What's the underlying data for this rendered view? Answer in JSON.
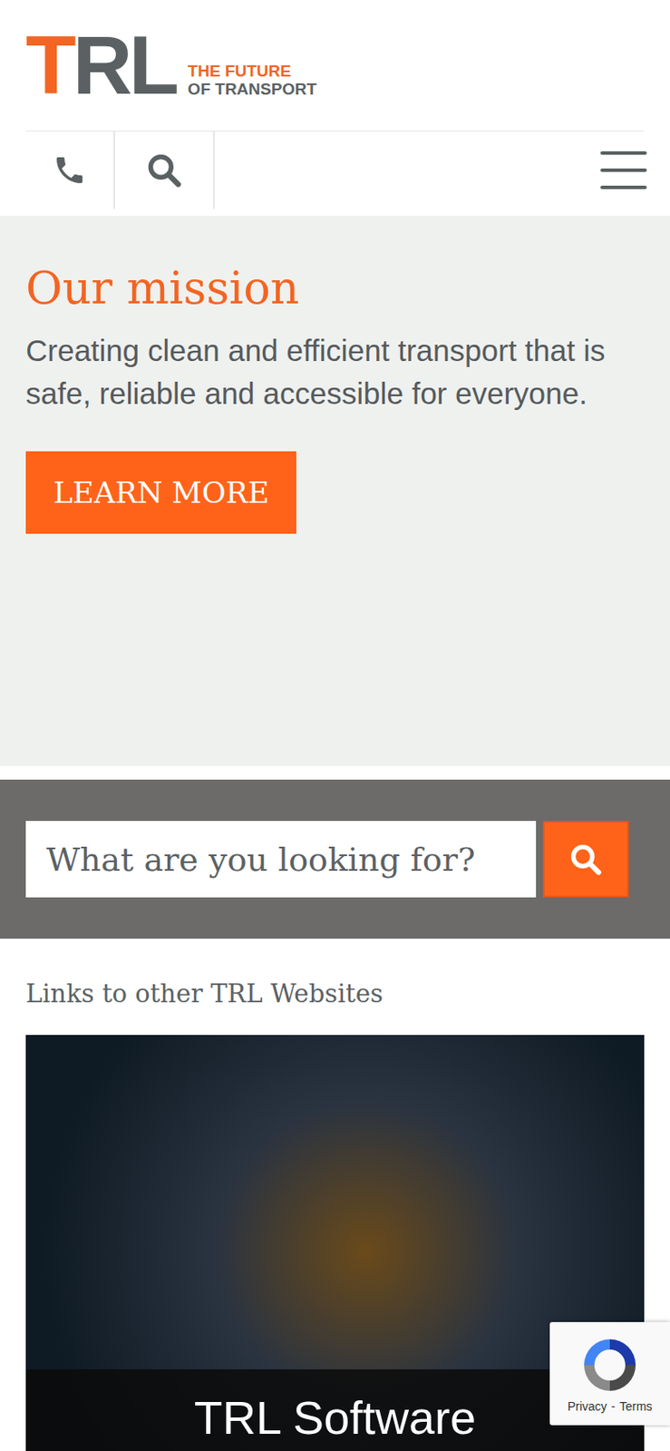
{
  "logo": {
    "letters": [
      {
        "char": "T",
        "color": "#f26522"
      },
      {
        "char": "R",
        "color": "#5b6163"
      },
      {
        "char": "L",
        "color": "#5b6163"
      }
    ],
    "tagline": [
      {
        "text": "THE FUTURE",
        "color": "#f26522"
      },
      {
        "text": "OF TRANSPORT",
        "color": "#5b6163"
      }
    ]
  },
  "mission": {
    "title": "Our mission",
    "text": "Creating clean and efficient transport that is safe, reliable and accessible for everyone.",
    "button": "LEARN MORE"
  },
  "search": {
    "placeholder": "What are you looking for?"
  },
  "links": {
    "title": "Links to other TRL Websites",
    "cards": [
      {
        "caption": "TRL Software"
      }
    ]
  },
  "recaptcha": {
    "links": [
      "Privacy",
      "Terms"
    ],
    "separator": "-"
  }
}
